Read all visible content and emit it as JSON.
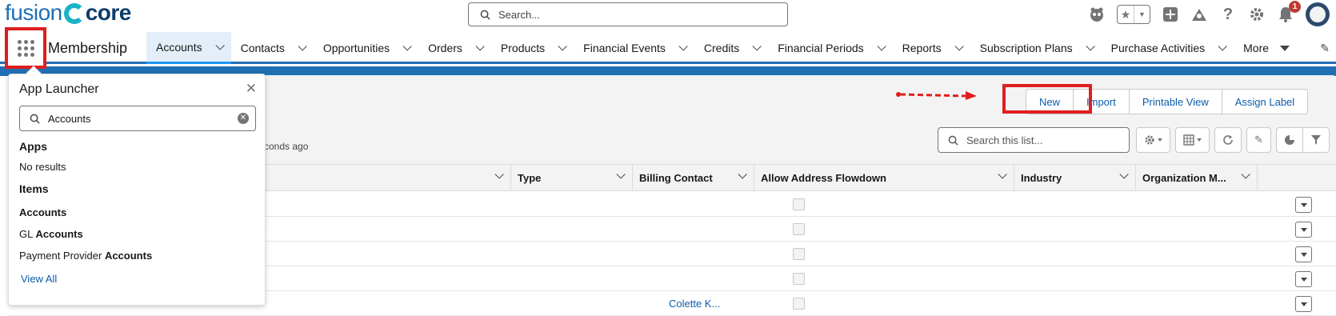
{
  "header": {
    "logo_part1": "fusion",
    "logo_part2": "core",
    "search_placeholder": "Search...",
    "notification_count": "1"
  },
  "nav": {
    "app_name": "Membership",
    "tabs": [
      {
        "label": "Accounts",
        "active": true
      },
      {
        "label": "Contacts"
      },
      {
        "label": "Opportunities"
      },
      {
        "label": "Orders"
      },
      {
        "label": "Products"
      },
      {
        "label": "Financial Events"
      },
      {
        "label": "Credits"
      },
      {
        "label": "Financial Periods"
      },
      {
        "label": "Reports"
      },
      {
        "label": "Subscription Plans"
      },
      {
        "label": "Purchase Activities"
      }
    ],
    "more_label": "More"
  },
  "list_view": {
    "actions": {
      "new": "New",
      "import": "Import",
      "printable_view": "Printable View",
      "assign_label": "Assign Label"
    },
    "updated_text": "conds ago",
    "search_placeholder": "Search this list...",
    "columns": [
      {
        "label": "Type"
      },
      {
        "label": "Billing Contact"
      },
      {
        "label": "Allow Address Flowdown"
      },
      {
        "label": "Industry"
      },
      {
        "label": "Organization M..."
      }
    ],
    "partial_cell_text": "Colette K..."
  },
  "app_launcher": {
    "title": "App Launcher",
    "search_value": "Accounts",
    "apps_heading": "Apps",
    "apps_no_results": "No results",
    "items_heading": "Items",
    "items": [
      {
        "prefix": "",
        "match": "Accounts"
      },
      {
        "prefix": "GL ",
        "match": "Accounts"
      },
      {
        "prefix": "Payment Provider ",
        "match": "Accounts"
      }
    ],
    "view_all": "View All"
  },
  "colors": {
    "brand_blue": "#1f6fb5",
    "link_blue": "#0b5cab",
    "highlight_red": "#e01e1e"
  }
}
